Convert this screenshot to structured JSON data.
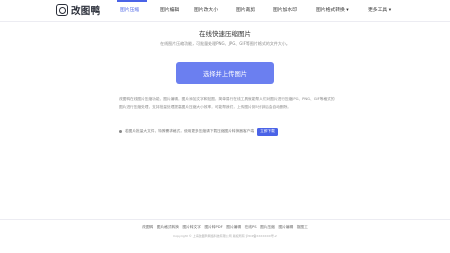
{
  "brand": {
    "name": "改图鸭"
  },
  "nav": {
    "items": [
      {
        "label": "图片压缩",
        "active": true
      },
      {
        "label": "图片编辑",
        "active": false
      },
      {
        "label": "图片改大小",
        "active": false
      },
      {
        "label": "图片裁剪",
        "active": false
      },
      {
        "label": "图片加水印",
        "active": false
      },
      {
        "label": "图片格式转换 ▾",
        "active": false
      },
      {
        "label": "更多工具 ▾",
        "active": false
      }
    ],
    "active_color": "#4a63e7"
  },
  "main": {
    "title": "在线快速压缩图片",
    "subtitle": "在线图片压缩功能，可批量处理PNG、JPG、GIF等图片格式的文件大小。",
    "upload_button": "选择并上传图片",
    "description": "改图鸭在线图片压缩功能，图片编辑，图片添加文字和贴图，简单易行在线工具就能帮人们对图片进行压缩JPG、PNG、GIF等格式的图片进行压缩处理，支持批量处理提高图片压缩大小效率，可能帮我们，上传图片到5分钟后会自动删除。",
    "tip_text": "若图片批量大文件，特殊需求格式，使用更多压缩请下载压缩图片转换器客户端",
    "tip_button": "立即下载"
  },
  "footer": {
    "links": [
      "改图鸭",
      "图片格式转换",
      "图片转文字",
      "图片转PDF",
      "图片编辑",
      "在线PS",
      "图片压缩",
      "图片编辑",
      "抠图工"
    ],
    "copyright": "Copyright © 上海改图鸭网络科技有限公司 版权所有 沪ICP备XXXXXXX号-2"
  }
}
